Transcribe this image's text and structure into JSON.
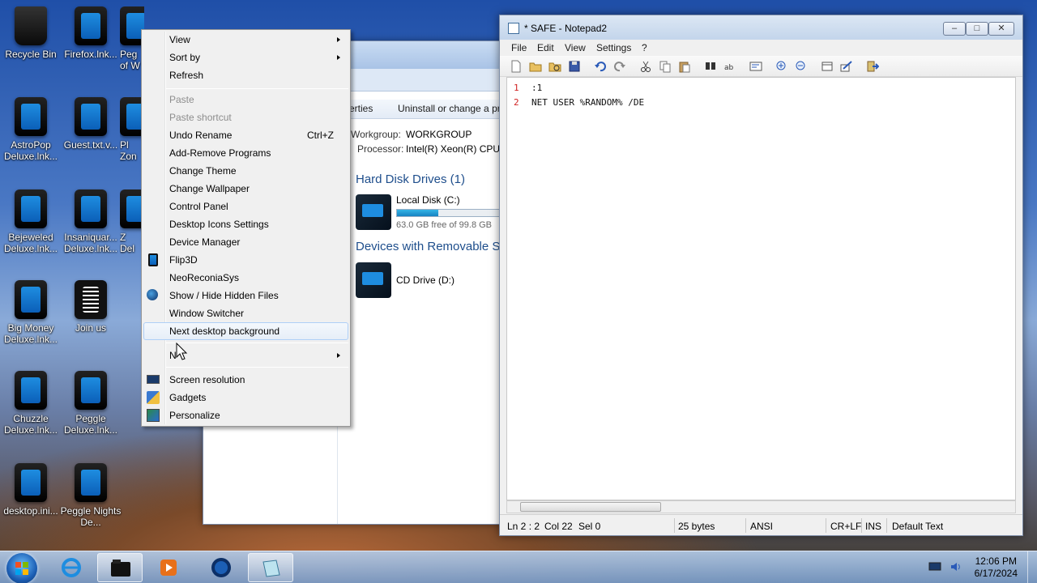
{
  "desktop": {
    "icons": [
      {
        "label": "Recycle Bin",
        "icon": "recycle-bin-icon"
      },
      {
        "label": "Firefox.lnk...",
        "icon": "shortcut-icon"
      },
      {
        "label": "Peg of W",
        "icon": "shortcut-icon"
      },
      {
        "label": "AstroPop Deluxe.lnk...",
        "icon": "shortcut-icon"
      },
      {
        "label": "Guest.txt.v...",
        "icon": "shortcut-icon"
      },
      {
        "label": "Pl Zon",
        "icon": "shortcut-icon"
      },
      {
        "label": "Bejeweled Deluxe.lnk...",
        "icon": "shortcut-icon"
      },
      {
        "label": "Insaniquar... Deluxe.lnk...",
        "icon": "shortcut-icon"
      },
      {
        "label": "Z Del",
        "icon": "shortcut-icon"
      },
      {
        "label": "Big Money Deluxe.lnk...",
        "icon": "shortcut-icon"
      },
      {
        "label": "Join us",
        "icon": "document-icon"
      },
      {
        "label": "Chuzzle Deluxe.lnk...",
        "icon": "shortcut-icon"
      },
      {
        "label": "Peggle Deluxe.lnk...",
        "icon": "shortcut-icon"
      },
      {
        "label": "desktop.ini...",
        "icon": "shortcut-icon"
      },
      {
        "label": "Peggle Nights De...",
        "icon": "shortcut-icon"
      }
    ]
  },
  "explorer": {
    "cmd_properties": "erties",
    "cmd_uninstall": "Uninstall or change a pr",
    "workgroup_label": "Workgroup:",
    "workgroup_value": "WORKGROUP",
    "processor_label": "Processor:",
    "processor_value": "Intel(R) Xeon(R) CPU E",
    "hdd_section": "Hard Disk Drives (1)",
    "local_disk_name": "Local Disk (C:)",
    "local_disk_free": "63.0 GB free of 99.8 GB",
    "local_disk_used_fraction": 0.37,
    "removable_section": "Devices with Removable St",
    "cd_drive_name": "CD Drive (D:)"
  },
  "context_menu": {
    "view": "View",
    "sort_by": "Sort by",
    "refresh": "Refresh",
    "paste": "Paste",
    "paste_shortcut": "Paste shortcut",
    "undo_rename": "Undo Rename",
    "undo_shortcut": "Ctrl+Z",
    "add_remove": "Add-Remove Programs",
    "change_theme": "Change Theme",
    "change_wallpaper": "Change Wallpaper",
    "control_panel": "Control Panel",
    "desktop_icons": "Desktop Icons Settings",
    "device_manager": "Device Manager",
    "flip3d": "Flip3D",
    "neoreconia": "NeoReconiaSys",
    "show_hide": "Show / Hide Hidden Files",
    "window_switcher": "Window Switcher",
    "next_bg": "Next desktop background",
    "new": "N",
    "screen_res": "Screen resolution",
    "gadgets": "Gadgets",
    "personalize": "Personalize"
  },
  "notepad": {
    "title": "* SAFE - Notepad2",
    "menu": {
      "file": "File",
      "edit": "Edit",
      "view": "View",
      "settings": "Settings",
      "help": "?"
    },
    "lines": [
      {
        "num": "1",
        "text": ":1"
      },
      {
        "num": "2",
        "text": "NET USER %RANDOM% /DE"
      }
    ],
    "status": {
      "pos": "Ln 2 : 2",
      "col": "Col 22",
      "sel": "Sel 0",
      "bytes": "25 bytes",
      "encoding": "ANSI",
      "eol": "CR+LF",
      "ins": "INS",
      "scheme": "Default Text"
    }
  },
  "taskbar": {
    "time": "12:06 PM",
    "date": "6/17/2024"
  }
}
